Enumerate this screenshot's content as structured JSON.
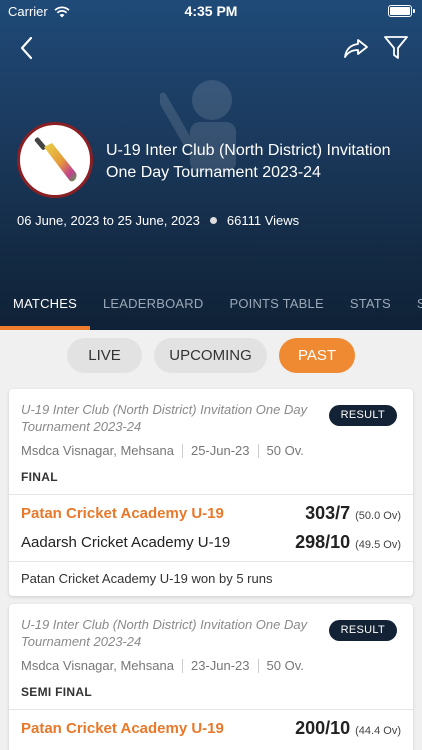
{
  "status_bar": {
    "carrier": "Carrier",
    "time": "4:35 PM"
  },
  "tournament": {
    "title": "U-19 Inter Club (North District) Invitation One Day Tournament 2023-24",
    "dates": "06 June, 2023 to 25 June, 2023",
    "views": "66111 Views"
  },
  "tabs": [
    "MATCHES",
    "LEADERBOARD",
    "POINTS TABLE",
    "STATS",
    "SPONSORS"
  ],
  "filters": {
    "live": "LIVE",
    "upcoming": "UPCOMING",
    "past": "PAST"
  },
  "matches": [
    {
      "tournament": "U-19 Inter Club (North District) Invitation One Day Tournament 2023-24",
      "badge": "RESULT",
      "venue": "Msdca Visnagar, Mehsana",
      "date": "25-Jun-23",
      "overs": "50 Ov.",
      "round": "FINAL",
      "team1": "Patan Cricket Academy U-19",
      "team1_score": "303/7",
      "team1_overs": "(50.0 Ov)",
      "team2": "Aadarsh Cricket Academy U-19",
      "team2_score": "298/10",
      "team2_overs": "(49.5 Ov)",
      "result": "Patan Cricket Academy U-19 won by 5 runs"
    },
    {
      "tournament": "U-19 Inter Club (North District) Invitation One Day Tournament 2023-24",
      "badge": "RESULT",
      "venue": "Msdca Visnagar, Mehsana",
      "date": "23-Jun-23",
      "overs": "50 Ov.",
      "round": "SEMI FINAL",
      "team1": "Patan Cricket Academy U-19",
      "team1_score": "200/10",
      "team1_overs": "(44.4 Ov)"
    }
  ],
  "colors": {
    "accent": "#f08a32",
    "header_dark": "#142b45",
    "badge": "#142235"
  },
  "icons": [
    "wifi-icon",
    "battery-icon",
    "back-arrow-icon",
    "share-icon",
    "filter-icon",
    "cricket-bat-logo"
  ]
}
